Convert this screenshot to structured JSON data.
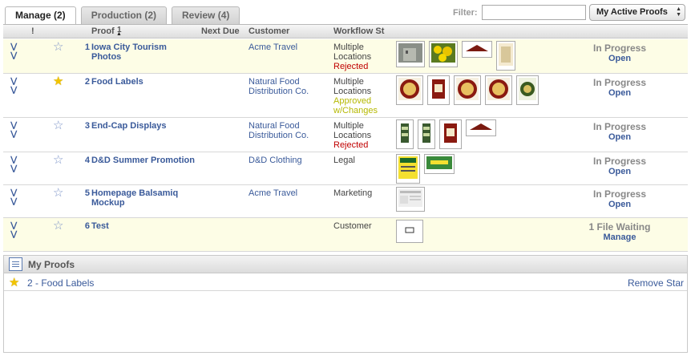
{
  "tabs": [
    {
      "label": "Manage (2)",
      "active": true
    },
    {
      "label": "Production (2)",
      "active": false
    },
    {
      "label": "Review (4)",
      "active": false
    }
  ],
  "filter": {
    "label": "Filter:",
    "value": "",
    "placeholder": ""
  },
  "view_select": {
    "value": "My Active Proofs"
  },
  "columns": {
    "flag": "!",
    "proof": "Proof",
    "sort_indicator": "1",
    "next_due": "Next Due",
    "customer": "Customer",
    "workflow": "Workflow St"
  },
  "rows": [
    {
      "num": "1",
      "title": "Iowa City Tourism Photos",
      "starred": false,
      "customer": "Acme Travel",
      "workflow": [
        "Multiple",
        "Locations"
      ],
      "wf_status": "Rejected",
      "wf_status_type": "rejected",
      "status": "In Progress",
      "action": "Open",
      "thumbs": [
        "photo-building",
        "photo-flowers",
        "label-banner",
        "label-tag"
      ]
    },
    {
      "num": "2",
      "title": "Food Labels",
      "starred": true,
      "customer": "Natural Food Distribution Co.",
      "workflow": [
        "Multiple",
        "Locations"
      ],
      "wf_status": "Approved w/Changes",
      "wf_status_type": "approved",
      "status": "In Progress",
      "action": "Open",
      "thumbs": [
        "label-round",
        "label-jar",
        "label-round",
        "label-round",
        "label-round-green"
      ]
    },
    {
      "num": "3",
      "title": "End-Cap Displays",
      "starred": false,
      "customer": "Natural Food Distribution Co.",
      "workflow": [
        "Multiple",
        "Locations"
      ],
      "wf_status": "Rejected",
      "wf_status_type": "rejected",
      "status": "In Progress",
      "action": "Open",
      "thumbs": [
        "display-green",
        "display-green",
        "label-jar",
        "label-banner"
      ]
    },
    {
      "num": "4",
      "title": "D&D Summer Promotion",
      "starred": false,
      "customer": "D&D Clothing",
      "workflow": [
        "Legal"
      ],
      "wf_status": "",
      "wf_status_type": "",
      "status": "In Progress",
      "action": "Open",
      "thumbs": [
        "poster-yellow",
        "logo-dd"
      ]
    },
    {
      "num": "5",
      "title": "Homepage Balsamiq Mockup",
      "starred": false,
      "customer": "Acme Travel",
      "workflow": [
        "Marketing"
      ],
      "wf_status": "",
      "wf_status_type": "",
      "status": "In Progress",
      "action": "Open",
      "thumbs": [
        "mockup-page"
      ]
    },
    {
      "num": "6",
      "title": "Test",
      "starred": false,
      "customer": "",
      "workflow": [
        "Customer"
      ],
      "wf_status": "",
      "wf_status_type": "",
      "status": "1 File Waiting",
      "action": "Manage",
      "thumbs": [
        "blank-doc"
      ]
    }
  ],
  "my_proofs": {
    "title": "My Proofs",
    "items": [
      {
        "label": "2 - Food Labels",
        "action": "Remove Star"
      }
    ]
  },
  "colors": {
    "link": "#3a5a9a",
    "rejected": "#c00000",
    "approved": "#b5b800",
    "row_highlight": "#fdfde6",
    "star": "#f2c400"
  }
}
